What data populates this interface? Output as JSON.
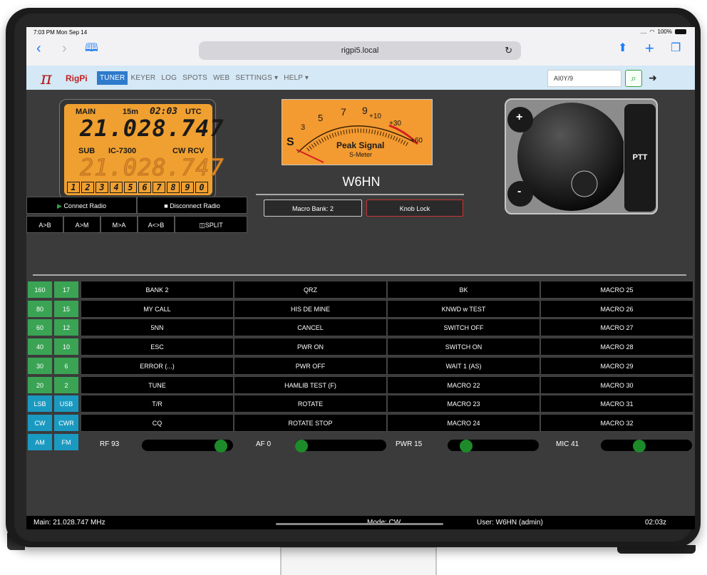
{
  "status_bar": {
    "time": "7:03 PM  Mon Sep 14",
    "battery": "100%"
  },
  "browser": {
    "url": "rigpi5.local"
  },
  "app": {
    "logo_text": "RigPi",
    "nav": [
      "TUNER",
      "KEYER",
      "LOG",
      "SPOTS",
      "WEB",
      "SETTINGS ▾",
      "HELP ▾"
    ],
    "active_nav": "TUNER",
    "callsign_input": "AI0Y/9"
  },
  "lcd": {
    "main_label": "MAIN",
    "band": "15m",
    "utc_time": "02:03",
    "utc_label": "UTC",
    "main_freq": "21.028.747",
    "sub_label": "SUB",
    "radio_model": "IC-7300",
    "mode_label": "CW RCV",
    "sub_freq": "21.028.747",
    "keys": [
      "1",
      "2",
      "3",
      "4",
      "5",
      "6",
      "7",
      "8",
      "9",
      "0"
    ]
  },
  "meter": {
    "s_label": "S",
    "scale_left": [
      "1",
      "3",
      "5",
      "7",
      "9"
    ],
    "scale_plus": [
      "+10",
      "+30",
      "+60"
    ],
    "inner_scale": [
      "10",
      "20",
      "30",
      "40",
      "50",
      "60",
      "70",
      "80",
      "90"
    ],
    "title": "Peak Signal",
    "subtitle": "S-Meter"
  },
  "callsign": "W6HN",
  "radio_buttons": {
    "connect": "Connect Radio",
    "disconnect": "Disconnect Radio",
    "a_to_b": "A>B",
    "a_to_m": "A>M",
    "m_to_a": "M>A",
    "a_swap_b": "A<>B",
    "split": "SPLIT"
  },
  "macro_bank": "Macro Bank: 2",
  "knob_lock": "Knob Lock",
  "knob": {
    "plus": "+",
    "minus": "-",
    "ptt": "PTT"
  },
  "band_buttons": [
    [
      "160",
      "17"
    ],
    [
      "80",
      "15"
    ],
    [
      "60",
      "12"
    ],
    [
      "40",
      "10"
    ],
    [
      "30",
      "6"
    ],
    [
      "20",
      "2"
    ]
  ],
  "mode_buttons": [
    [
      "LSB",
      "USB"
    ],
    [
      "CW",
      "CWR"
    ],
    [
      "AM",
      "FM"
    ]
  ],
  "macros": [
    [
      "BANK 2",
      "QRZ",
      "BK",
      "MACRO 25"
    ],
    [
      "MY CALL",
      "HIS DE MINE",
      "KNWD w TEST",
      "MACRO 26"
    ],
    [
      "5NN",
      "CANCEL",
      "SWITCH OFF",
      "MACRO 27"
    ],
    [
      "ESC",
      "PWR ON",
      "SWITCH ON",
      "MACRO 28"
    ],
    [
      "ERROR (...)",
      "PWR OFF",
      "WAIT 1 (AS)",
      "MACRO 29"
    ],
    [
      "TUNE",
      "HAMLIB TEST (F)",
      "MACRO 22",
      "MACRO 30"
    ],
    [
      "T/R",
      "ROTATE",
      "MACRO 23",
      "MACRO 31"
    ],
    [
      "CQ",
      "ROTATE STOP",
      "MACRO 24",
      "MACRO 32"
    ]
  ],
  "sliders": [
    {
      "label": "RF 93",
      "value": 93
    },
    {
      "label": "AF 0",
      "value": 0
    },
    {
      "label": "PWR 15",
      "value": 15
    },
    {
      "label": "MIC 41",
      "value": 41
    }
  ],
  "footer": {
    "main": "Main: 21.028.747 MHz",
    "mode": "Mode: CW",
    "user": "User: W6HN (admin)",
    "time": "02:03z"
  },
  "colors": {
    "band_green": "#3aa454",
    "mode_teal": "#1b9ac1",
    "lcd_orange": "#f0a030",
    "accent_blue": "#2e7bcc"
  }
}
